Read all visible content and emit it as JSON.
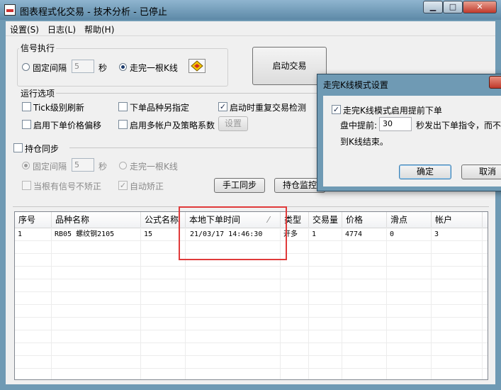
{
  "window": {
    "title": "图表程式化交易 - 技术分析 - 已停止",
    "min": "▁",
    "max": "□",
    "close": "✕"
  },
  "menu": [
    "设置(S)",
    "日志(L)",
    "帮助(H)"
  ],
  "signal": {
    "label": "信号执行",
    "fixed_interval": "固定间隔",
    "interval_value": "5",
    "seconds": "秒",
    "bar_complete": "走完一根K线",
    "start_button": "启动交易"
  },
  "run_options": {
    "label": "运行选项",
    "tick_refresh": "Tick级别刷新",
    "order_other_symbol": "下单品种另指定",
    "restart_dup_check": "启动时重复交易检测",
    "price_offset": "启用下单价格偏移",
    "multi_account": "启用多帐户及策略系数",
    "settings_button": "设置"
  },
  "position_sync": {
    "label": "持仓同步",
    "fixed_interval": "固定间隔",
    "interval_value": "5",
    "seconds": "秒",
    "bar_complete": "走完一根K线",
    "no_correct": "当根有信号不矫正",
    "auto_correct": "自动矫正",
    "manual_sync": "手工同步",
    "position_monitor": "持仓监控"
  },
  "table": {
    "headers": [
      "序号",
      "品种名称",
      "公式名称",
      "本地下单时间",
      "类型",
      "交易量",
      "价格",
      "滑点",
      "帐户"
    ],
    "rows": [
      [
        "1",
        "RB05 螺纹钢2105",
        "15",
        "21/03/17 14:46:30",
        "开多",
        "1",
        "4774",
        "0",
        "3"
      ]
    ]
  },
  "dialog": {
    "title": "走完K线模式设置",
    "enable_label": "走完K线模式启用提前下单",
    "advance_prefix": "盘中提前:",
    "advance_value": "30",
    "advance_suffix": "秒发出下单指令，而不",
    "advance_line2": "到K线结束。",
    "ok": "确定",
    "cancel": "取消"
  }
}
